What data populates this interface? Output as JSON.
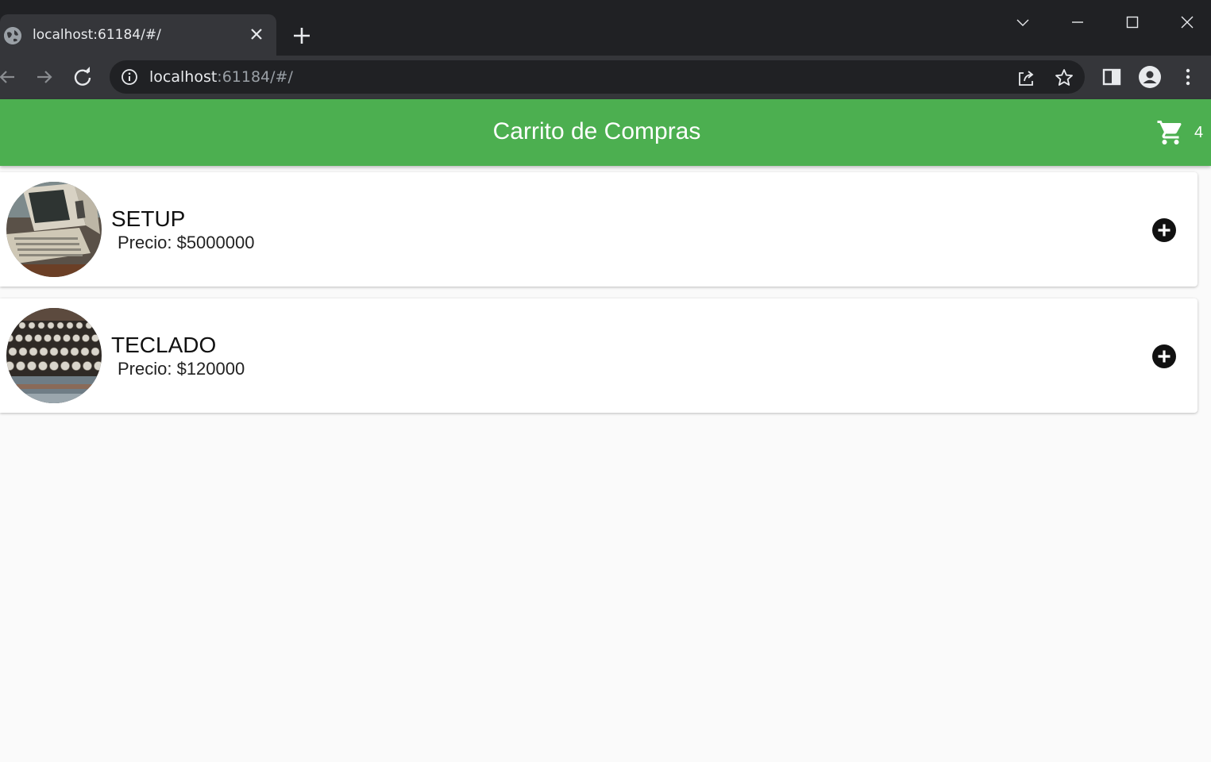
{
  "browser": {
    "tab_title": "localhost:61184/#/",
    "url_host": "localhost",
    "url_rest": ":61184/#/",
    "icons": [
      "globe-icon",
      "close-icon",
      "plus-icon",
      "chevron-down-icon",
      "minimize-icon",
      "maximize-icon",
      "close-window-icon",
      "back-icon",
      "forward-icon",
      "reload-icon",
      "info-icon",
      "share-icon",
      "star-icon",
      "side-panel-icon",
      "profile-icon",
      "kebab-menu-icon"
    ]
  },
  "app": {
    "title": "Carrito de Compras",
    "cart_count": "4",
    "accent_color": "#4caf50"
  },
  "products": [
    {
      "name": "SETUP",
      "price": "Precio: $5000000",
      "image": "vintage computer"
    },
    {
      "name": "TECLADO",
      "price": "Precio: $120000",
      "image": "typewriter keys"
    }
  ]
}
